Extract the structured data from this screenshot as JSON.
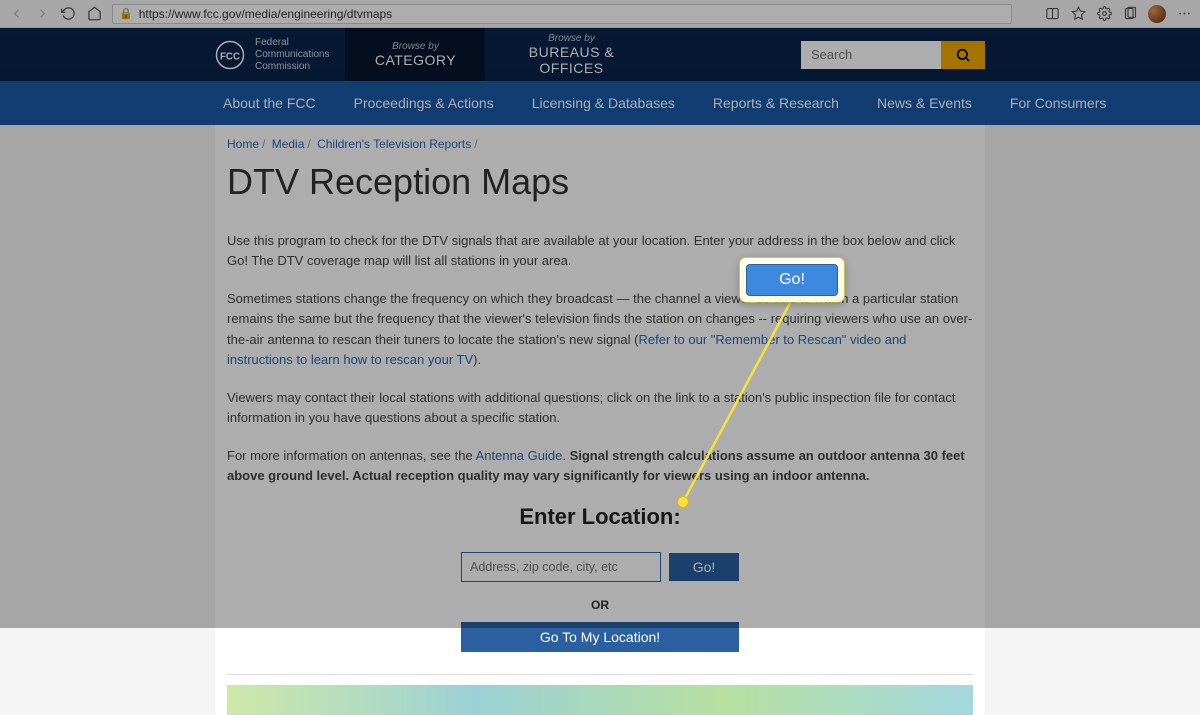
{
  "browser": {
    "url": "https://www.fcc.gov/media/engineering/dtvmaps"
  },
  "header": {
    "logo_line1": "Federal",
    "logo_line2": "Communications",
    "logo_line3": "Commission",
    "browse_by": "Browse by",
    "category": "CATEGORY",
    "bureaus": "BUREAUS & OFFICES",
    "search_placeholder": "Search"
  },
  "nav": {
    "items": [
      "About the FCC",
      "Proceedings & Actions",
      "Licensing & Databases",
      "Reports & Research",
      "News & Events",
      "For Consumers"
    ]
  },
  "breadcrumbs": {
    "items": [
      "Home",
      "Media",
      "Children's Television Reports"
    ]
  },
  "page": {
    "title": "DTV Reception Maps",
    "p1": "Use this program to check for the DTV signals that are available at your location. Enter your address in the box below and click Go! The DTV coverage map will list all stations in your area.",
    "p2a": "Sometimes stations change the frequency on which they broadcast — the channel a viewer selects to watch a particular station remains the same but the frequency that the viewer's television finds the station on changes -- requiring viewers who use an over-the-air antenna to rescan their tuners to locate the station's new signal (",
    "p2_link": "Refer to our \"Remember to Rescan\" video and instructions to learn how to rescan your TV",
    "p2b": ").",
    "p3": "Viewers may contact their local stations with additional questions; click on the link to a station's public inspection file for contact information in you have questions about a specific station.",
    "p4a": "For more information on antennas, see the ",
    "p4_link": "Antenna Guide",
    "p4b": ". ",
    "p4_bold": "Signal strength calculations assume an outdoor antenna 30 feet above ground level. Actual reception quality may vary significantly for viewers using an indoor antenna.",
    "enter_location": "Enter Location:",
    "address_placeholder": "Address, zip code, city, etc",
    "go": "Go!",
    "or": "OR",
    "my_location": "Go To My Location!"
  },
  "callout": {
    "go": "Go!"
  }
}
